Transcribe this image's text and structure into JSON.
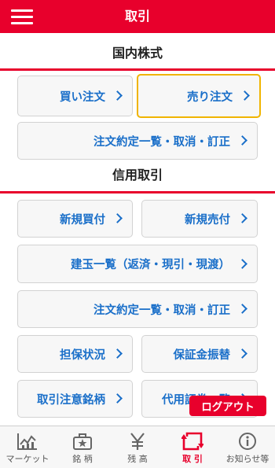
{
  "header": {
    "title": "取引",
    "menu_icon": "hamburger-menu-icon"
  },
  "sections": {
    "stock": {
      "title": "国内株式",
      "buttons": {
        "buy": "買い注文",
        "sell": "売り注文",
        "orders": "注文約定一覧・取消・訂正"
      }
    },
    "margin": {
      "title": "信用取引",
      "buttons": {
        "new_buy": "新規買付",
        "new_sell": "新規売付",
        "positions": "建玉一覧（返済・現引・現渡）",
        "orders": "注文約定一覧・取消・訂正",
        "collateral": "担保状況",
        "deposit": "保証金振替",
        "caution": "取引注意銘柄",
        "substitute": "代用証券一覧"
      }
    }
  },
  "logout": "ログアウト",
  "tabs": [
    {
      "label": "マーケット",
      "icon": "market-chart-icon"
    },
    {
      "label": "銘 柄",
      "icon": "briefcase-star-icon"
    },
    {
      "label": "残 高",
      "icon": "yen-icon"
    },
    {
      "label": "取 引",
      "icon": "trade-exchange-icon",
      "active": true
    },
    {
      "label": "お知らせ等",
      "icon": "info-icon"
    }
  ],
  "colors": {
    "brand": "#e8002c",
    "link": "#1a6fc9",
    "selected_border": "#f0b400"
  }
}
